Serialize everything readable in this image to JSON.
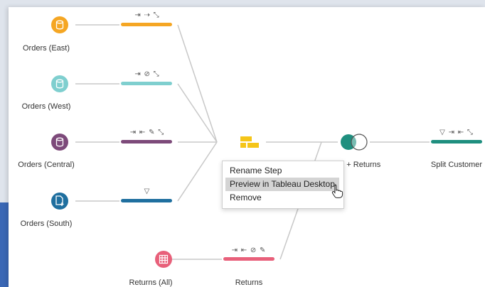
{
  "inputs": [
    {
      "label": "Orders (East)",
      "color": "#f5a623",
      "icon": "database-icon"
    },
    {
      "label": "Orders (West)",
      "color": "#7fcfcf",
      "icon": "database-icon"
    },
    {
      "label": "Orders (Central)",
      "color": "#7d4a7a",
      "icon": "database-icon"
    },
    {
      "label": "Orders (South)",
      "color": "#1f6f9f",
      "icon": "file-add-icon"
    },
    {
      "label": "Returns (All)",
      "color": "#e8607a",
      "icon": "table-icon"
    }
  ],
  "steps": [
    {
      "icons": "⇥ ⇢ ⤡",
      "color": "#f5a623"
    },
    {
      "icons": "⇥ ⊘ ⤡",
      "color": "#7fcfcf"
    },
    {
      "icons": "⇥ ⇤ ✎ ⤡",
      "color": "#7d4a7a"
    },
    {
      "icons": "▽",
      "color": "#1f6f9f"
    },
    {
      "icons": "⇥ ⇤ ⊘ ✎",
      "color": "#e8607a",
      "label": "Returns"
    }
  ],
  "union": {
    "icon": "union-icon",
    "color": "#f5c518"
  },
  "join": {
    "label": "s + Returns",
    "icon": "join-icon",
    "color": "#1f8f7f"
  },
  "split": {
    "label": "Split Customer",
    "icons": "▽ ⇥ ⇤ ⤡",
    "color": "#1f8f7f"
  },
  "context_menu": {
    "items": [
      "Rename Step",
      "Preview in Tableau Desktop",
      "Remove"
    ],
    "highlighted_index": 1
  }
}
